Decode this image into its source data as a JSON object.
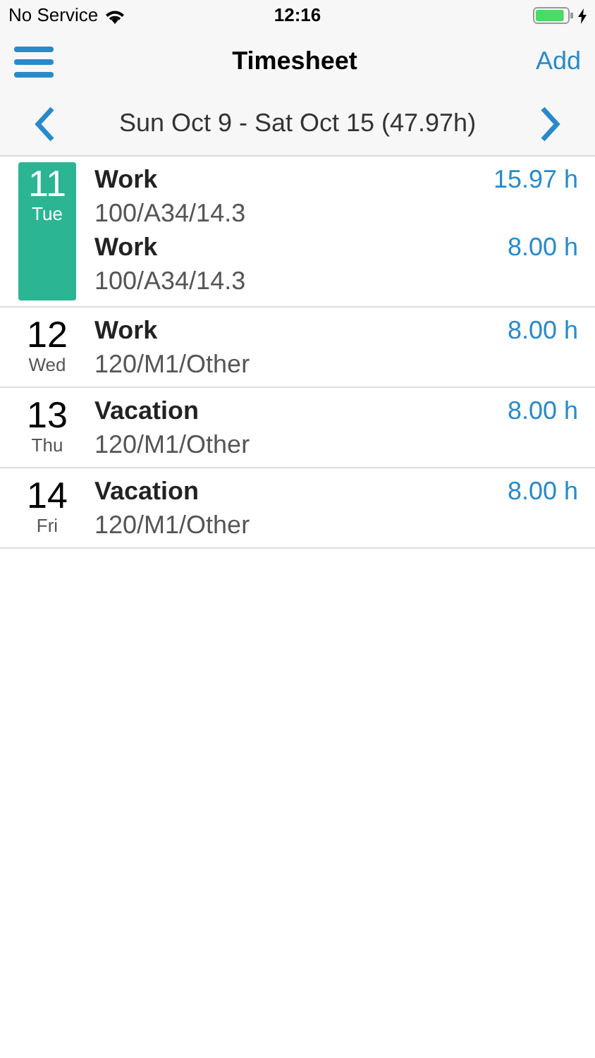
{
  "status_bar": {
    "carrier": "No Service",
    "time": "12:16",
    "battery": {
      "level": 0.9
    }
  },
  "nav": {
    "title": "Timesheet",
    "action": "Add"
  },
  "week": {
    "label": "Sun Oct 9 - Sat Oct 15 (47.97h)"
  },
  "days": [
    {
      "day": "11",
      "weekday": "Tue",
      "selected": true,
      "entries": [
        {
          "type": "Work",
          "code": "100/A34/14.3",
          "hours": "15.97 h"
        },
        {
          "type": "Work",
          "code": "100/A34/14.3",
          "hours": "8.00 h"
        }
      ]
    },
    {
      "day": "12",
      "weekday": "Wed",
      "selected": false,
      "entries": [
        {
          "type": "Work",
          "code": "120/M1/Other",
          "hours": "8.00 h"
        }
      ]
    },
    {
      "day": "13",
      "weekday": "Thu",
      "selected": false,
      "entries": [
        {
          "type": "Vacation",
          "code": "120/M1/Other",
          "hours": "8.00 h"
        }
      ]
    },
    {
      "day": "14",
      "weekday": "Fri",
      "selected": false,
      "entries": [
        {
          "type": "Vacation",
          "code": "120/M1/Other",
          "hours": "8.00 h"
        }
      ]
    }
  ]
}
